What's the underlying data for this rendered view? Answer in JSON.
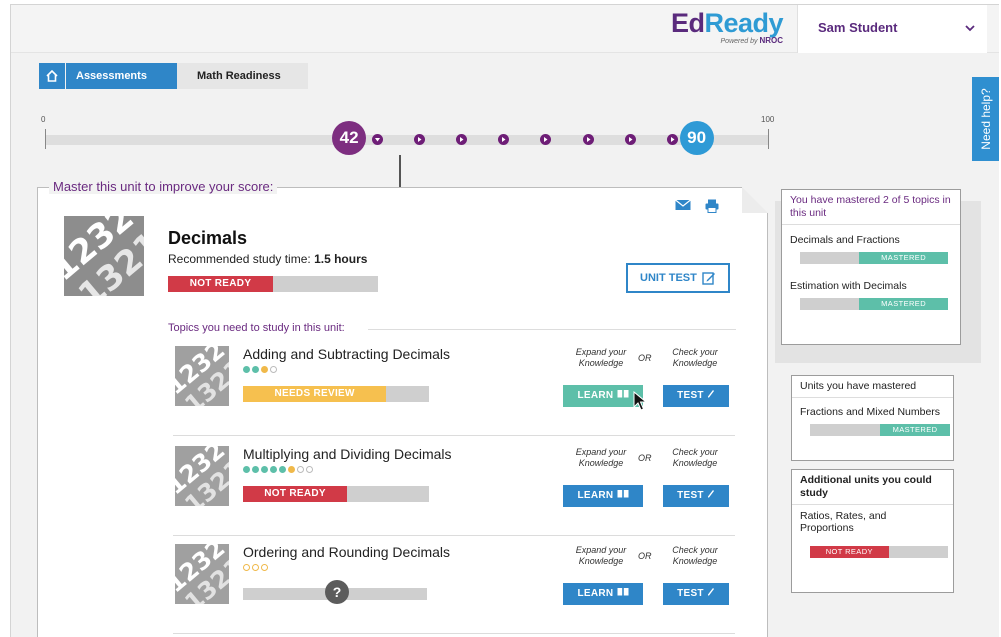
{
  "header": {
    "logo_ed": "Ed",
    "logo_ready": "Ready",
    "logo_powered": "Powered by",
    "logo_brand": "NROC",
    "user_name": "Sam Student"
  },
  "breadcrumb": {
    "items": [
      "Assessments",
      "Math Readiness"
    ]
  },
  "need_help": "Need help?",
  "scale": {
    "min_label": "0",
    "max_label": "100",
    "min": 0,
    "max": 100,
    "current_score": "42",
    "target_score": "90",
    "current_value": 42,
    "target_value": 90,
    "steps": 8
  },
  "unit": {
    "section_title": "Master this unit to improve your score:",
    "title": "Decimals",
    "study_time_label": "Recommended study time:",
    "study_time_value": "1.5 hours",
    "status": "NOT READY",
    "status_fraction": 0.5,
    "unit_test_label": "UNIT TEST",
    "topics_label": "Topics you need to study in this unit:"
  },
  "topic_common": {
    "expand_line1": "Expand your",
    "expand_line2": "Knowledge",
    "or": "OR",
    "check_line1": "Check your",
    "check_line2": "Knowledge",
    "learn_label": "LEARN",
    "test_label": "TEST"
  },
  "topics": [
    {
      "name": "Adding and Subtracting Decimals",
      "status": "NEEDS REVIEW",
      "dots_filled": 3,
      "dots_total": 4,
      "status_fraction": 0.77
    },
    {
      "name": "Multiplying and Dividing Decimals",
      "status": "NOT READY",
      "dots_filled": 6,
      "dots_total": 8,
      "status_fraction": 0.56
    },
    {
      "name": "Ordering and Rounding Decimals",
      "status": "?",
      "dots_filled": 0,
      "dots_total": 3,
      "status_fraction": 0
    }
  ],
  "mastered_box": {
    "title": "You have mastered 2 of 5 topics in this unit",
    "items": [
      {
        "name": "Decimals and Fractions",
        "status": "MASTERED"
      },
      {
        "name": "Estimation with Decimals",
        "status": "MASTERED"
      }
    ]
  },
  "units_mastered_box": {
    "title": "Units you have mastered",
    "items": [
      {
        "name": "Fractions and Mixed Numbers",
        "status": "MASTERED"
      }
    ]
  },
  "additional_box": {
    "title": "Additional units you could study",
    "items": [
      {
        "name": "Ratios, Rates, and Proportions",
        "status": "NOT READY"
      }
    ]
  },
  "colors": {
    "purple": "#6a2a80",
    "blue": "#2f86c8",
    "teal": "#5dbfa9",
    "red": "#d13a47",
    "yellow": "#f6c04f"
  }
}
